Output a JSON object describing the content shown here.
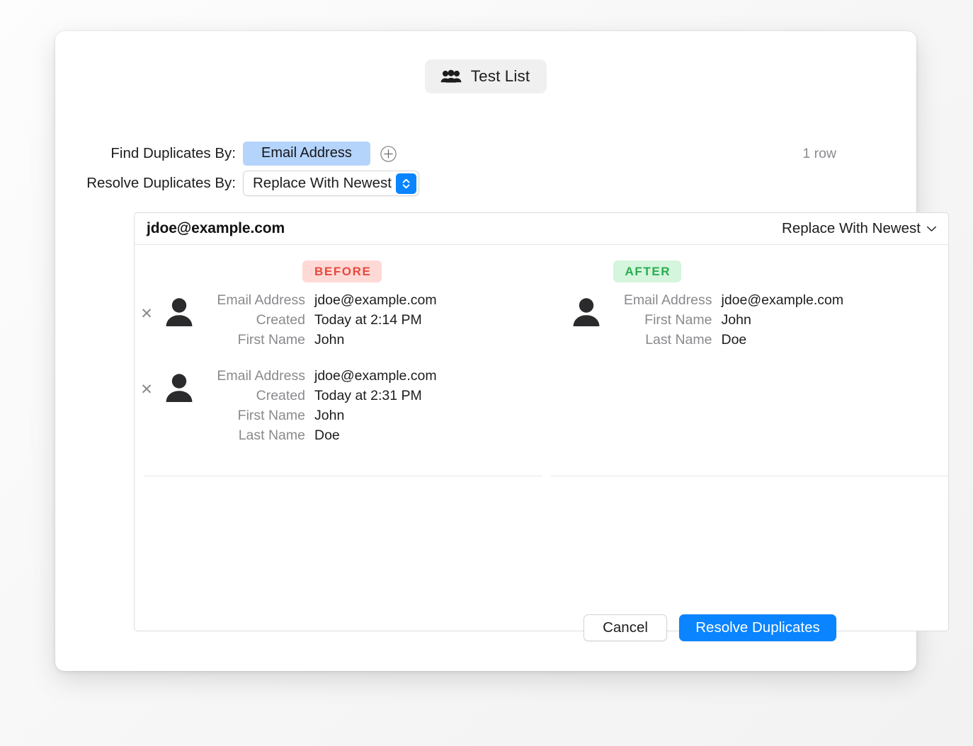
{
  "window": {
    "title": "Test List",
    "title_icon": "people-group-icon"
  },
  "form": {
    "find_label": "Find Duplicates By:",
    "find_token": "Email Address",
    "add_criteria_icon": "plus-circle-icon",
    "resolve_label": "Resolve Duplicates By:",
    "resolve_value": "Replace With Newest",
    "resolve_stepper_icon": "up-down-chevron-icon",
    "row_count": "1 row"
  },
  "table": {
    "group_key": "jdoe@example.com",
    "group_action": "Replace With Newest",
    "group_action_icon": "chevron-down-icon",
    "before_badge": "BEFORE",
    "after_badge": "AFTER",
    "remove_icon": "close-x-icon",
    "avatar_icon": "person-avatar-icon",
    "before_records": [
      {
        "fields": [
          {
            "label": "Email Address",
            "value": "jdoe@example.com"
          },
          {
            "label": "Created",
            "value": "Today at 2:14 PM"
          },
          {
            "label": "First Name",
            "value": "John"
          }
        ]
      },
      {
        "fields": [
          {
            "label": "Email Address",
            "value": "jdoe@example.com"
          },
          {
            "label": "Created",
            "value": "Today at 2:31 PM"
          },
          {
            "label": "First Name",
            "value": "John"
          },
          {
            "label": "Last Name",
            "value": "Doe"
          }
        ]
      }
    ],
    "after_records": [
      {
        "fields": [
          {
            "label": "Email Address",
            "value": "jdoe@example.com"
          },
          {
            "label": "First Name",
            "value": "John"
          },
          {
            "label": "Last Name",
            "value": "Doe"
          }
        ]
      }
    ]
  },
  "footer": {
    "cancel_label": "Cancel",
    "confirm_label": "Resolve Duplicates"
  },
  "colors": {
    "accent_blue": "#0a84ff",
    "token_blue": "#b5d4fb",
    "badge_before_bg": "#ffd9d6",
    "badge_before_fg": "#e8493d",
    "badge_after_bg": "#d5f5dd",
    "badge_after_fg": "#28ad4d"
  }
}
